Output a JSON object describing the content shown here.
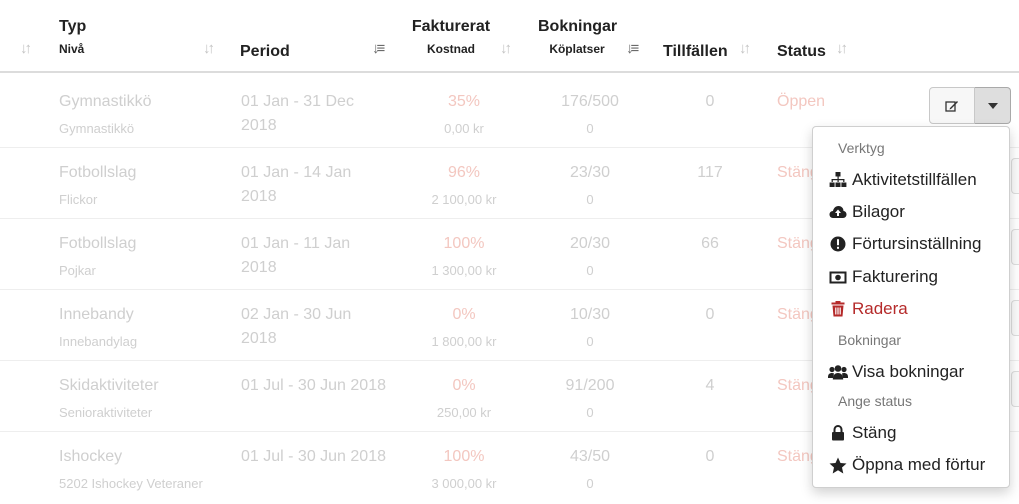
{
  "table": {
    "headers": {
      "typ": "Typ",
      "niva": "Nivå",
      "period": "Period",
      "fakturerat": "Fakturerat",
      "kostnad": "Kostnad",
      "bokningar": "Bokningar",
      "koplatser": "Köplatser",
      "tillfallen": "Tillfällen",
      "status": "Status"
    },
    "rows": [
      {
        "typ": "Gymnastikkö",
        "niva": "Gymnastikkö",
        "period_1": "01 Jan - 31 Dec",
        "period_2": "2018",
        "fakturerat": "35%",
        "kostnad": "0,00 kr",
        "bokningar": "176/500",
        "koplatser": "0",
        "tillfallen": "0",
        "status": "Öppen"
      },
      {
        "typ": "Fotbollslag",
        "niva": "Flickor",
        "period_1": "01 Jan - 14 Jan",
        "period_2": "2018",
        "fakturerat": "96%",
        "kostnad": "2 100,00 kr",
        "bokningar": "23/30",
        "koplatser": "0",
        "tillfallen": "117",
        "status": "Stäng"
      },
      {
        "typ": "Fotbollslag",
        "niva": "Pojkar",
        "period_1": "01 Jan - 11 Jan",
        "period_2": "2018",
        "fakturerat": "100%",
        "kostnad": "1 300,00 kr",
        "bokningar": "20/30",
        "koplatser": "0",
        "tillfallen": "66",
        "status": "Stäng"
      },
      {
        "typ": "Innebandy",
        "niva": "Innebandylag",
        "period_1": "02 Jan - 30 Jun",
        "period_2": "2018",
        "fakturerat": "0%",
        "kostnad": "1 800,00 kr",
        "bokningar": "10/30",
        "koplatser": "0",
        "tillfallen": "0",
        "status": "Stäng"
      },
      {
        "typ": "Skidaktiviteter",
        "niva": "Senioraktiviteter",
        "period_1": "01 Jul - 30 Jun 2018",
        "period_2": "",
        "fakturerat": "0%",
        "kostnad": "250,00 kr",
        "bokningar": "91/200",
        "koplatser": "0",
        "tillfallen": "4",
        "status": "Stäng"
      },
      {
        "typ": "Ishockey",
        "niva": "5202 Ishockey Veteraner",
        "period_1": "01 Jul - 30 Jun 2018",
        "period_2": "",
        "fakturerat": "100%",
        "kostnad": "3 000,00 kr",
        "bokningar": "43/50",
        "koplatser": "0",
        "tillfallen": "0",
        "status": "Stäng"
      }
    ]
  },
  "dropdown": {
    "header_verktyg": "Verktyg",
    "aktivitetstillfallen": "Aktivitetstillfällen",
    "bilagor": "Bilagor",
    "fortursinstallning": "Förtursinställning",
    "fakturering": "Fakturering",
    "radera": "Radera",
    "header_bokningar": "Bokningar",
    "visa_bokningar": "Visa bokningar",
    "header_status": "Ange status",
    "stang": "Stäng",
    "oppna_med_fortur": "Öppna med förtur"
  },
  "icons": {
    "sort": "sort-icon",
    "sort_active": "sort-amount-icon",
    "edit": "edit-icon",
    "caret": "caret-down-icon",
    "sitemap": "sitemap-icon",
    "cloud_upload": "cloud-upload-icon",
    "exclamation": "exclamation-circle-icon",
    "money": "money-icon",
    "trash": "trash-icon",
    "users": "users-icon",
    "lock": "lock-icon",
    "star": "star-icon"
  },
  "colors": {
    "danger": "#b52a2a",
    "muted_text": "#cfcfcf",
    "status_text": "#f3c7c0"
  }
}
